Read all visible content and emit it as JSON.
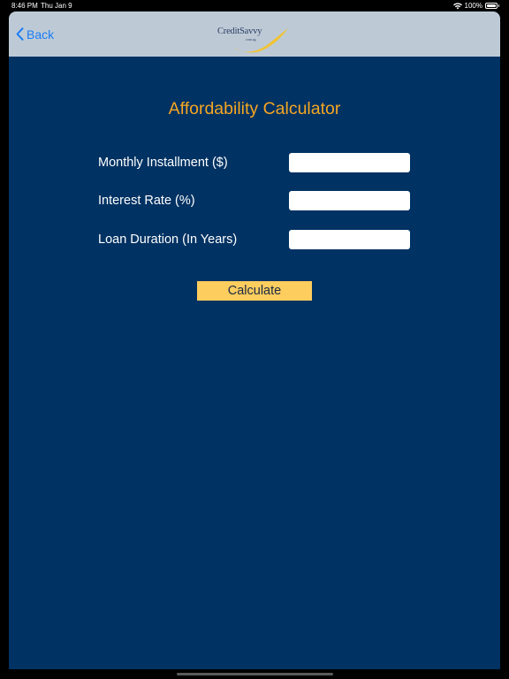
{
  "status_bar": {
    "time": "8:46 PM",
    "date": "Thu Jan 9",
    "battery": "100%",
    "icons": [
      "wifi-icon",
      "battery-icon"
    ]
  },
  "nav": {
    "back_label": "Back",
    "back_icon": "chevron-left-icon",
    "logo_text": "CreditSavvy",
    "logo_subtext": ".com.sg"
  },
  "form": {
    "title": "Affordability Calculator",
    "fields": [
      {
        "label": "Monthly Installment ($)",
        "value": "",
        "placeholder": ""
      },
      {
        "label": "Interest Rate (%)",
        "value": "",
        "placeholder": ""
      },
      {
        "label": "Loan Duration (In Years)",
        "value": "",
        "placeholder": ""
      }
    ],
    "calculate_label": "Calculate"
  },
  "colors": {
    "background": "#003263",
    "nav_bar": "#bdcad6",
    "accent_title": "#f6a623",
    "button": "#fdcd5e",
    "link": "#1a7cf5"
  }
}
